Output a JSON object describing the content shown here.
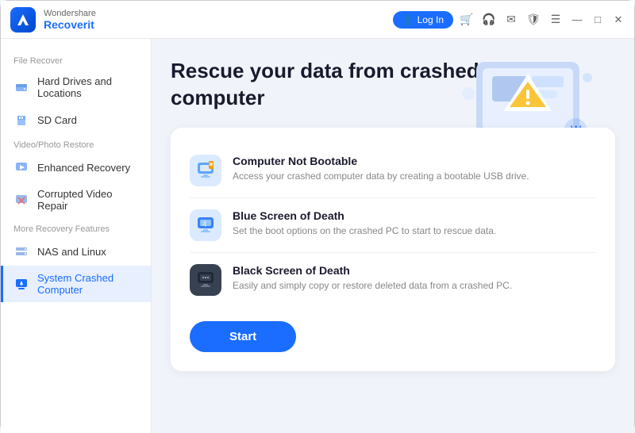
{
  "app": {
    "brand": "Wondershare",
    "title": "Recoverit",
    "logo_char": "R"
  },
  "titlebar": {
    "login_label": "Log In",
    "icons": [
      "🛒",
      "🎧",
      "✉",
      "🛡",
      "☰",
      "—",
      "□",
      "✕"
    ]
  },
  "sidebar": {
    "section_file_recover": "File Recover",
    "section_video_photo": "Video/Photo Restore",
    "section_more": "More Recovery Features",
    "items": [
      {
        "id": "hard-drives",
        "label": "Hard Drives and Locations",
        "icon": "💾",
        "active": false
      },
      {
        "id": "sd-card",
        "label": "SD Card",
        "icon": "📱",
        "active": false
      },
      {
        "id": "enhanced-recovery",
        "label": "Enhanced Recovery",
        "icon": "🎬",
        "active": false
      },
      {
        "id": "corrupted-video",
        "label": "Corrupted Video Repair",
        "icon": "🔧",
        "active": false
      },
      {
        "id": "nas-linux",
        "label": "NAS and Linux",
        "icon": "📊",
        "active": false
      },
      {
        "id": "system-crashed",
        "label": "System Crashed Computer",
        "icon": "💻",
        "active": true
      }
    ]
  },
  "main": {
    "heading_line1": "Rescue your data from crashed",
    "heading_line2": "computer",
    "options": [
      {
        "title": "Computer Not Bootable",
        "desc": "Access your crashed computer data by creating a bootable USB drive.",
        "icon_type": "blue"
      },
      {
        "title": "Blue Screen of Death",
        "desc": "Set the boot options on the crashed PC to start to rescue data.",
        "icon_type": "blue"
      },
      {
        "title": "Black Screen of Death",
        "desc": "Easily and simply copy or restore deleted data from a crashed PC.",
        "icon_type": "dark"
      }
    ],
    "start_label": "Start"
  },
  "colors": {
    "accent": "#1a6dff",
    "active_bg": "#e8f0ff",
    "card_bg": "#ffffff"
  }
}
